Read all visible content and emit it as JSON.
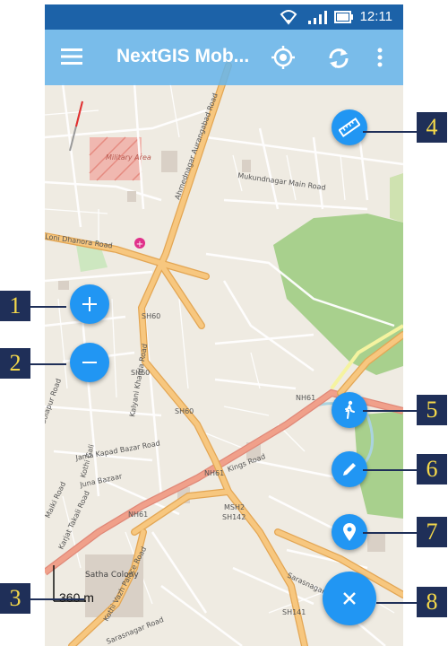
{
  "status_bar": {
    "time": "12:11"
  },
  "app_bar": {
    "title": "NextGIS Mob..."
  },
  "map": {
    "labels": [
      "Military Area",
      "Mukundnagar Main Road",
      "Ahmednagar Aurangabad Road",
      "Loni Dhanora Road",
      "SH60",
      "SH60",
      "SH60",
      "NH61",
      "NH61",
      "NH61",
      "Kings Road",
      "Juna Bazaar",
      "Jama Kapad Bazar Road",
      "MSH2",
      "SH142",
      "SH141",
      "Satha Colony",
      "Kothi Vazh Palace Road",
      "Kothi Gali",
      "Sarasnagar Road",
      "Sarasnagar Road",
      "Kalyani Kharda Road",
      "Solapur Road",
      "Maiki Road",
      "Karjat Takali Road"
    ],
    "scale_label": "360 m"
  },
  "callouts": [
    "1",
    "2",
    "3",
    "4",
    "5",
    "6",
    "7",
    "8"
  ],
  "fab_icons": [
    "plus-icon",
    "minus-icon",
    "ruler-icon",
    "walk-icon",
    "pencil-icon",
    "pin-icon",
    "close-icon"
  ],
  "colors": {
    "status_bar": "#1c62a8",
    "app_bar": "#64b4eb",
    "fab": "#2196f3",
    "callout_bg": "#1f2f58",
    "callout_text": "#f5d94a",
    "primary_road": "#f5c07a",
    "trunk_road": "#f0a08a",
    "park": "#a8d08d"
  }
}
